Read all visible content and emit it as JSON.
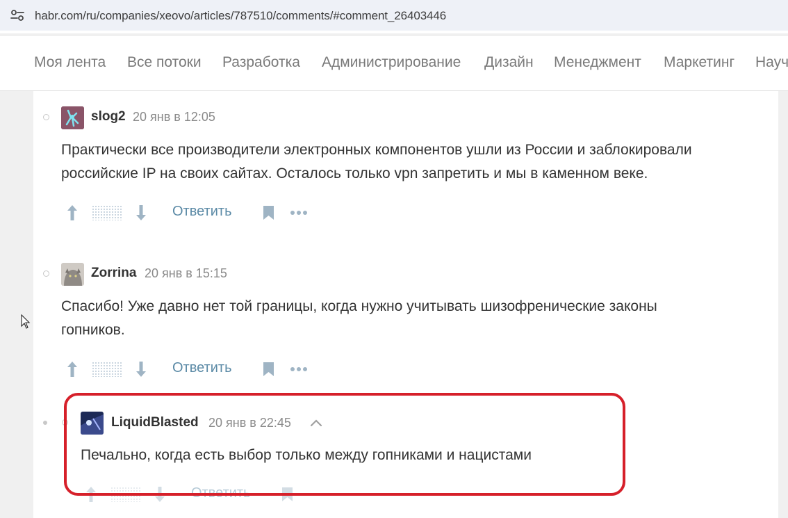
{
  "browser": {
    "url": "habr.com/ru/companies/xeovo/articles/787510/comments/#comment_26403446"
  },
  "flows": [
    "Моя лента",
    "Все потоки",
    "Разработка",
    "Администрирование",
    "Дизайн",
    "Менеджмент",
    "Маркетинг",
    "Науч"
  ],
  "comments": [
    {
      "user": "slog2",
      "time": "20 янв в 12:05",
      "text_line1": "Практически все производители электронных компонентов ушли из России и заблокировали",
      "text_line2": "российские IP на своих сайтах. Осталось только vpn запретить и мы в каменном веке.",
      "reply_label": "Ответить"
    },
    {
      "user": "Zorrina",
      "time": "20 янв в 15:15",
      "text_line1": "Спасибо! Уже давно нет той границы, когда нужно учитывать шизофренические законы",
      "text_line2": "гопников.",
      "reply_label": "Ответить"
    },
    {
      "user": "LiquidBlasted",
      "time": "20 янв в 22:45",
      "text_line1": "Печально, когда есть выбор только между гопниками и нацистами",
      "reply_label": "Ответить"
    }
  ],
  "colors": {
    "accent_link": "#5b8aa6",
    "highlight_border": "#d6202a"
  }
}
